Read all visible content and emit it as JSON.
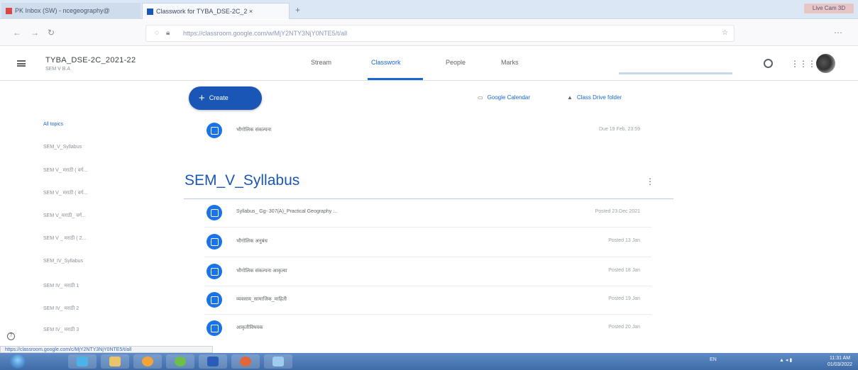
{
  "browser": {
    "tabs": [
      {
        "label": "PK Inbox (SW) - ncegeography@",
        "close": "×"
      },
      {
        "label": "Classwork for TYBA_DSE-2C_2 ×",
        "close": "×"
      }
    ],
    "new_tab": "+",
    "window_controls": "Live Cam 3D",
    "nav": {
      "back": "←",
      "forward": "→",
      "reload": "↻"
    },
    "url": "https://classroom.google.com/w/MjY2NTY3NjY0NTE5/t/all"
  },
  "classroom": {
    "menu_icon": "hamburger-menu-icon",
    "title": "TYBA_DSE-2C_2021-22",
    "subtitle": "SEM V B.A",
    "tabs": [
      "Stream",
      "Classwork",
      "People",
      "Marks"
    ],
    "active_tab": "Classwork",
    "accent": "#1967d2"
  },
  "sidebar": {
    "topics": [
      "All topics",
      "SEM_V_Syllabus",
      "SEM V_ मराठी ( वर्ग...",
      "SEM V_ मराठी ( वर्ग...",
      "SEM V_मराठी_ वर्ग...",
      "SEM V _ मराठी ( 2...",
      "SEM_IV_Syllabus",
      "SEM IV_ मराठी 1",
      "SEM IV_ मराठी 2",
      "SEM IV_ मराठी 3"
    ]
  },
  "toolbar": {
    "create_label": "Create",
    "calendar_label": "Google Calendar",
    "drive_label": "Class Drive folder"
  },
  "top_item": {
    "title": "भौगोलिक संकल्पना",
    "date": "Due 19 Feb, 23:59"
  },
  "section": {
    "title": "SEM_V_Syllabus",
    "more": "⋮",
    "items": [
      {
        "title": "Syllabus_ Gg- 307(A)_Practical Geography ...",
        "date": "Posted 23 Dec 2021"
      },
      {
        "title": "भौगोलिक अनुबंध",
        "date": "Posted 13 Jan"
      },
      {
        "title": "भौगोलिक संकल्पना आकृत्या",
        "date": "Posted 18 Jan"
      },
      {
        "title": "व्यवसाय_सामाजिक_माहिती",
        "date": "Posted 19 Jan"
      },
      {
        "title": "आकृतीविषयक",
        "date": "Posted 20 Jan"
      }
    ]
  },
  "status_url": "https://classroom.google.com/c/MjY2NTY3NjY0NTE5/t/all",
  "taskbar": {
    "lang": "EN",
    "tray": "▲ ◂ ▮",
    "time": "11:31 AM",
    "date": "01/03/2022"
  }
}
